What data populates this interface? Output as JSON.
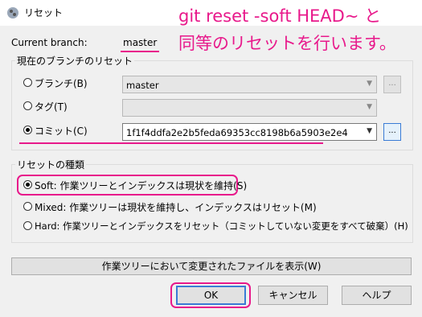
{
  "window": {
    "title": "リセット"
  },
  "annotation": {
    "line1": "git reset -soft HEAD~ と",
    "line2": "同等のリセットを行います。"
  },
  "branch": {
    "label": "Current branch:",
    "value": "master"
  },
  "reset_to_group": {
    "title": "現在のブランチのリセット",
    "options": [
      {
        "label": "ブランチ(B)",
        "value": "master",
        "selected": false
      },
      {
        "label": "タグ(T)",
        "value": "",
        "selected": false
      },
      {
        "label": "コミット(C)",
        "value": "1f1f4ddfa2e2b5feda69353cc8198b6a5903e2e4",
        "selected": true
      }
    ],
    "browse_label": "..."
  },
  "reset_type_group": {
    "title": "リセットの種類",
    "options": [
      {
        "label": "Soft: 作業ツリーとインデックスは現状を維持(S)",
        "selected": true
      },
      {
        "label": "Mixed: 作業ツリーは現状を維持し、インデックスはリセット(M)",
        "selected": false
      },
      {
        "label": "Hard: 作業ツリーとインデックスをリセット（コミットしていない変更をすべて破棄）(H)",
        "selected": false
      }
    ]
  },
  "buttons": {
    "show_changed": "作業ツリーにおいて変更されたファイルを表示(W)",
    "ok": "OK",
    "cancel": "キャンセル",
    "help": "ヘルプ"
  },
  "colors": {
    "annotation": "#e8198b",
    "accent": "#3a7bd5"
  }
}
